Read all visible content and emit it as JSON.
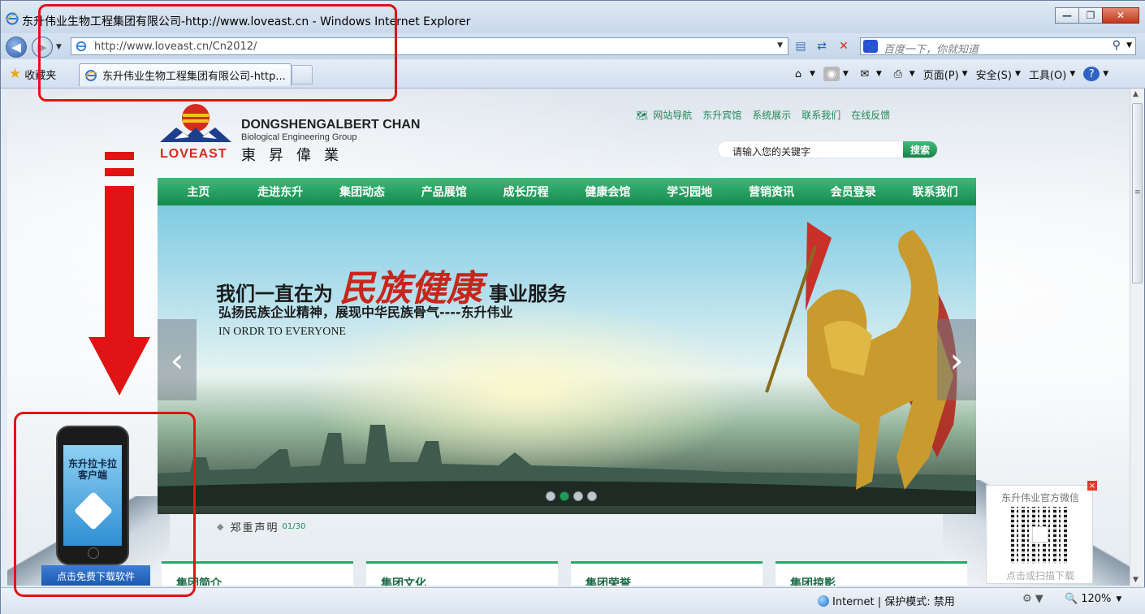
{
  "window": {
    "title": "东升伟业生物工程集团有限公司-http://www.loveast.cn - Windows Internet Explorer",
    "controls": [
      "—",
      "❐",
      "✕"
    ]
  },
  "address_bar": {
    "url": "http://www.loveast.cn/Cn2012/",
    "search_placeholder": "百度一下，你就知道"
  },
  "tab_bar": {
    "favorites_label": "收藏夹",
    "active_tab": "东升伟业生物工程集团有限公司-http...",
    "commands": {
      "page": "页面(P)",
      "safety": "安全(S)",
      "tools": "工具(O)"
    }
  },
  "site": {
    "logo_en": "DONGSHENGALBERT CHAN",
    "logo_sub": "Biological Engineering Group",
    "logo_cn": "東昇偉業",
    "logo_brand": "LOVEAST",
    "top_links": [
      "网站导航",
      "东升宾馆",
      "系统展示",
      "联系我们",
      "在线反馈"
    ],
    "search_placeholder": "请输入您的关键字",
    "search_button": "搜索",
    "nav": [
      "主页",
      "走进东升",
      "集团动态",
      "产品展馆",
      "成长历程",
      "健康会馆",
      "学习园地",
      "营销资讯",
      "会员登录",
      "联系我们"
    ],
    "banner": {
      "headline_pre": "我们一直在为",
      "headline_big": "民族健康",
      "headline_post": "事业服务",
      "slogan": "弘扬民族企业精神，展现中华民族骨气----东升伟业",
      "english": "IN ORDR TO EVERYONE",
      "slide_count": 4,
      "active_slide": 2
    },
    "notice": {
      "text": "郑重声明",
      "count": "01/30"
    },
    "cards": [
      "集团简介",
      "集团文化",
      "集团荣誉",
      "集团掠影"
    ],
    "phone_promo": {
      "screen_text": "东升拉卡拉\n客户端",
      "download_button": "点击免费下载软件"
    },
    "qr": {
      "title": "东升伟业官方微信",
      "caption": "点击或扫描下载",
      "close": "×"
    }
  },
  "status_bar": {
    "zone": "Internet | 保护模式: 禁用",
    "zoom": "120%"
  },
  "colors": {
    "nav_green": "#1f9a5a",
    "annotation_red": "#e01414",
    "headline_red": "#c8261c"
  }
}
